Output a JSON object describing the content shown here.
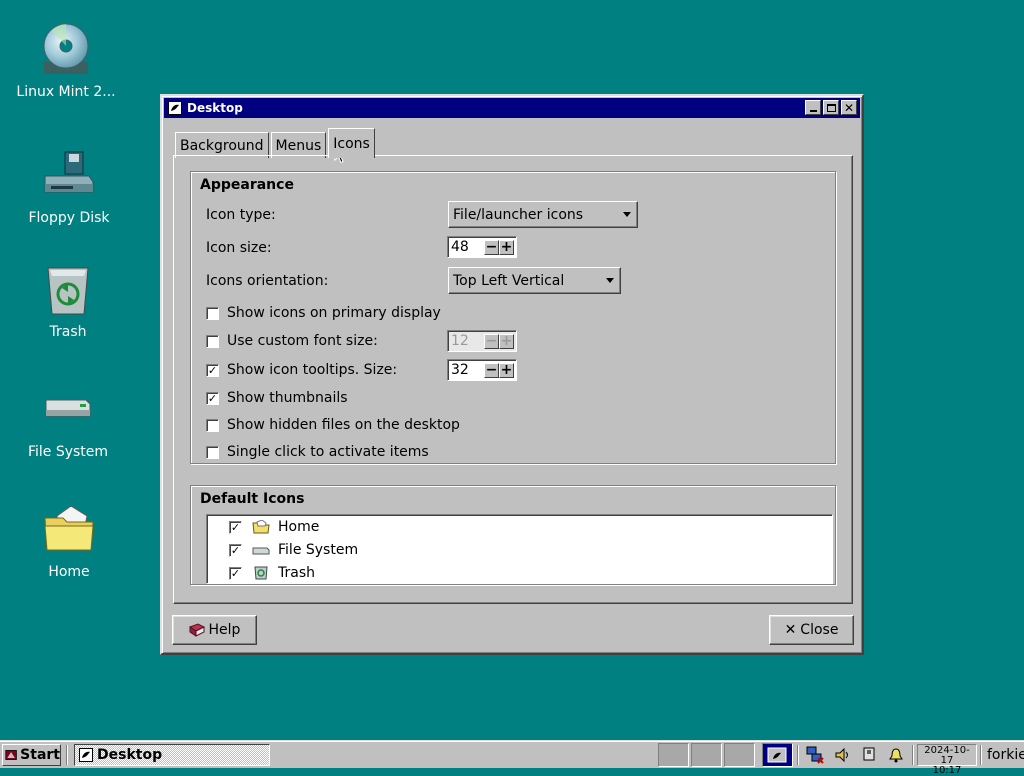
{
  "desktop": {
    "icons": [
      {
        "label": "Linux Mint 2...",
        "icon": "cd-disc-icon"
      },
      {
        "label": "Floppy Disk",
        "icon": "floppy-drive-icon"
      },
      {
        "label": "Trash",
        "icon": "trash-icon"
      },
      {
        "label": "File System",
        "icon": "hard-drive-icon"
      },
      {
        "label": "Home",
        "icon": "home-folder-icon"
      }
    ]
  },
  "window": {
    "title": "Desktop",
    "tabs": [
      {
        "label": "Background",
        "active": false
      },
      {
        "label": "Menus",
        "active": false
      },
      {
        "label": "Icons",
        "active": true
      }
    ],
    "appearance": {
      "title": "Appearance",
      "icon_type_label": "Icon type:",
      "icon_type_value": "File/launcher icons",
      "icon_size_label": "Icon size:",
      "icon_size_value": "48",
      "orientation_label": "Icons orientation:",
      "orientation_value": "Top Left Vertical",
      "show_primary_label": "Show icons on primary display",
      "show_primary_checked": false,
      "custom_font_label": "Use custom font size:",
      "custom_font_checked": false,
      "custom_font_value": "12",
      "tooltips_label": "Show icon tooltips. Size:",
      "tooltips_checked": true,
      "tooltips_value": "32",
      "thumbnails_label": "Show thumbnails",
      "thumbnails_checked": true,
      "hidden_label": "Show hidden files on the desktop",
      "hidden_checked": false,
      "single_click_label": "Single click to activate items",
      "single_click_checked": false
    },
    "default_icons": {
      "title": "Default Icons",
      "items": [
        {
          "label": "Home",
          "checked": true,
          "icon": "home-folder-icon"
        },
        {
          "label": "File System",
          "checked": true,
          "icon": "hard-drive-icon"
        },
        {
          "label": "Trash",
          "checked": true,
          "icon": "trash-icon"
        }
      ]
    },
    "help_label": "Help",
    "close_label": "Close"
  },
  "taskbar": {
    "start_label": "Start",
    "task_label": "Desktop",
    "clock_date": "2024-10-17",
    "clock_time": "10:17",
    "user": "forkie"
  }
}
